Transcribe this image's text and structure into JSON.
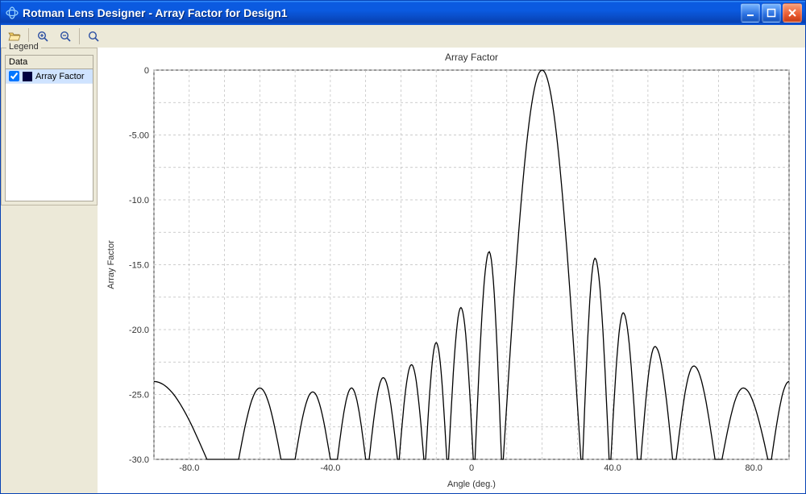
{
  "window": {
    "title": "Rotman Lens Designer - Array Factor for Design1"
  },
  "toolbar": {
    "open_tip": "Open",
    "zoom_in_tip": "Zoom In",
    "zoom_out_tip": "Zoom Out",
    "zoom_fit_tip": "Fit"
  },
  "legend": {
    "group_label": "Legend",
    "header": "Data",
    "items": [
      {
        "label": "Array Factor",
        "checked": true,
        "color": "#000040"
      }
    ]
  },
  "chart_data": {
    "type": "line",
    "title": "Array Factor",
    "xlabel": "Angle (deg.)",
    "ylabel": "Array Factor",
    "xlim": [
      -90,
      90
    ],
    "ylim": [
      -30,
      0
    ],
    "xticks": [
      -80,
      -40,
      0,
      40,
      80
    ],
    "yticks": [
      -30,
      -25,
      -20,
      -15,
      -10,
      -5,
      0
    ],
    "ytick_labels": [
      "-30.0",
      "-25.0",
      "-20.0",
      "-15.0",
      "-10.0",
      "-5.00",
      "0"
    ],
    "main_lobe_peak_deg": 20,
    "main_lobe_peak_db": 0,
    "series": [
      {
        "name": "Array Factor",
        "lobes": [
          {
            "type": "edge_left",
            "start_deg": -90,
            "start_db": -24.0,
            "null_deg": -75
          },
          {
            "peak_deg": -60,
            "peak_db": -24.5,
            "null_left_deg": -66,
            "null_right_deg": -54
          },
          {
            "peak_deg": -45,
            "peak_db": -24.8,
            "null_left_deg": -50,
            "null_right_deg": -40
          },
          {
            "peak_deg": -34,
            "peak_db": -24.5,
            "null_left_deg": -38,
            "null_right_deg": -30
          },
          {
            "peak_deg": -25,
            "peak_db": -23.7,
            "null_left_deg": -29,
            "null_right_deg": -21
          },
          {
            "peak_deg": -17,
            "peak_db": -22.7,
            "null_left_deg": -20.5,
            "null_right_deg": -13.5
          },
          {
            "peak_deg": -10,
            "peak_db": -21.0,
            "null_left_deg": -13,
            "null_right_deg": -7
          },
          {
            "peak_deg": -3,
            "peak_db": -18.3,
            "null_left_deg": -6.5,
            "null_right_deg": 0.5
          },
          {
            "peak_deg": 5,
            "peak_db": -14.0,
            "null_left_deg": 1,
            "null_right_deg": 8.5
          },
          {
            "peak_deg": 20,
            "peak_db": 0.0,
            "null_left_deg": 9,
            "null_right_deg": 31,
            "main": true
          },
          {
            "peak_deg": 35,
            "peak_db": -14.5,
            "null_left_deg": 31.5,
            "null_right_deg": 39
          },
          {
            "peak_deg": 43,
            "peak_db": -18.7,
            "null_left_deg": 39.5,
            "null_right_deg": 47
          },
          {
            "peak_deg": 52,
            "peak_db": -21.3,
            "null_left_deg": 48,
            "null_right_deg": 57
          },
          {
            "peak_deg": 63,
            "peak_db": -22.8,
            "null_left_deg": 58,
            "null_right_deg": 69
          },
          {
            "peak_deg": 77,
            "peak_db": -24.5,
            "null_left_deg": 71,
            "null_right_deg": 84
          },
          {
            "type": "edge_right",
            "null_deg": 85,
            "end_deg": 90,
            "end_db": -24.0
          }
        ]
      }
    ]
  }
}
